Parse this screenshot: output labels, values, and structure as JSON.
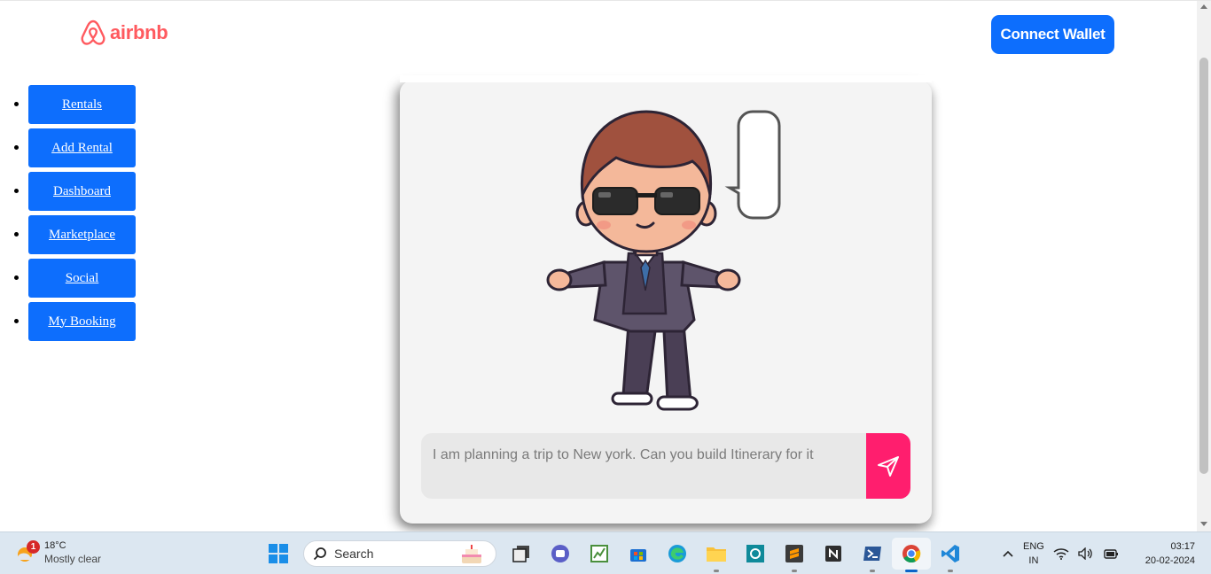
{
  "header": {
    "logo_text": "airbnb",
    "connect_wallet_label": "Connect Wallet",
    "brand_color": "#ff5a5f",
    "primary_color": "#0d6efd"
  },
  "nav": {
    "items": [
      {
        "label": "Rentals"
      },
      {
        "label": "Add Rental"
      },
      {
        "label": "Dashboard"
      },
      {
        "label": "Marketplace"
      },
      {
        "label": "Social"
      },
      {
        "label": "My Booking"
      }
    ]
  },
  "chat": {
    "input_value": "",
    "input_placeholder": "I am planning a trip to New york. Can you build Itinerary for it",
    "send_icon": "send-icon",
    "send_color": "#ff1e6e"
  },
  "taskbar": {
    "weather": {
      "notification_count": "1",
      "temp": "18°C",
      "condition": "Mostly clear"
    },
    "search_label": "Search",
    "language": {
      "line1": "ENG",
      "line2": "IN"
    },
    "clock": {
      "time": "03:17",
      "date": "20-02-2024"
    }
  }
}
